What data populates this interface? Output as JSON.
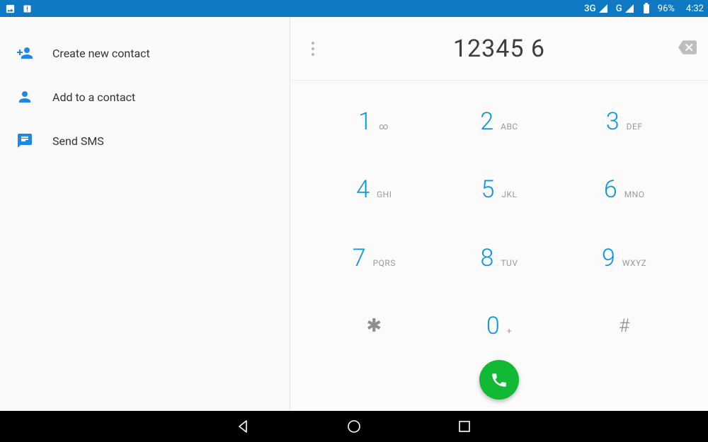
{
  "status_bar": {
    "net1": "3G",
    "net2": "G",
    "battery_pct": "96%",
    "clock": "4:32"
  },
  "actions": {
    "create_contact": "Create new contact",
    "add_to_contact": "Add to a contact",
    "send_sms": "Send SMS"
  },
  "dialer": {
    "typed": "12345 6",
    "keys": {
      "k1_sub": "∞",
      "k2_sub": "ABC",
      "k3_sub": "DEF",
      "k4_sub": "GHI",
      "k5_sub": "JKL",
      "k6_sub": "MNO",
      "k7_sub": "PQRS",
      "k8_sub": "TUV",
      "k9_sub": "WXYZ",
      "k0_sub": "+",
      "d1": "1",
      "d2": "2",
      "d3": "3",
      "d4": "4",
      "d5": "5",
      "d6": "6",
      "d7": "7",
      "d8": "8",
      "d9": "9",
      "d0": "0",
      "dstar": "✱",
      "dhash": "#"
    }
  }
}
